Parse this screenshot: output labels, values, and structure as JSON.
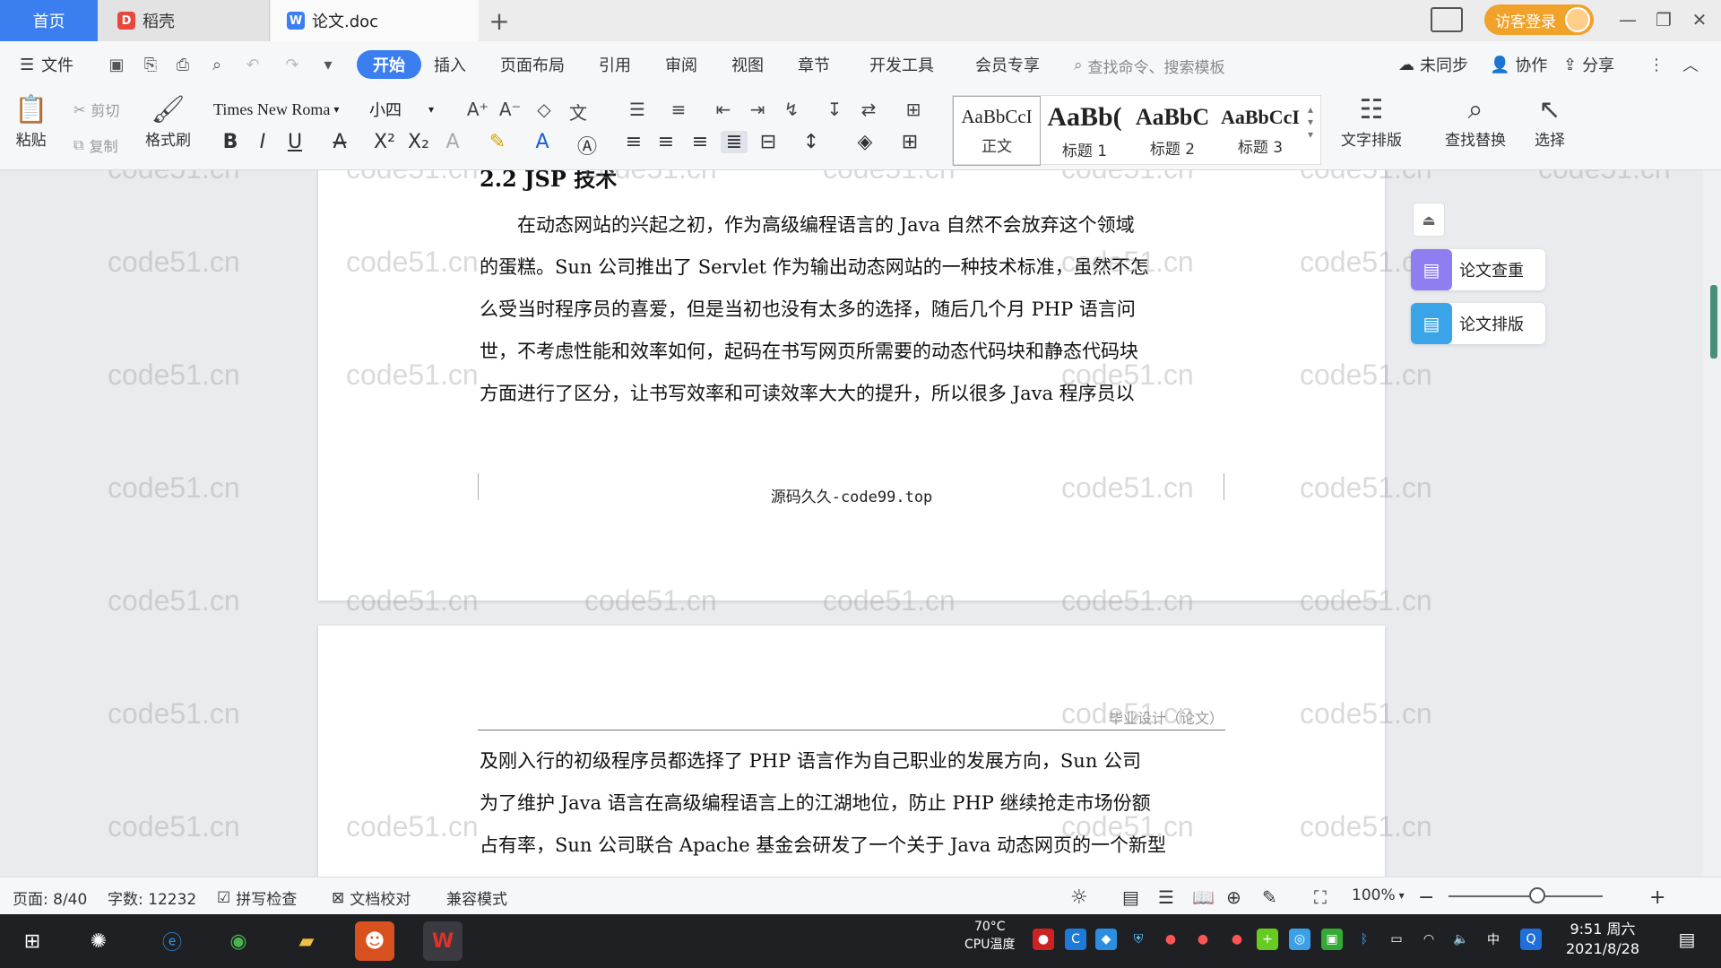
{
  "titlebar": {
    "tabs": [
      {
        "label": "首页"
      },
      {
        "label": "稻壳"
      },
      {
        "label": "论文.doc"
      }
    ],
    "login_label": "访客登录"
  },
  "menubar": {
    "file_label": "文件",
    "items": [
      "开始",
      "插入",
      "页面布局",
      "引用",
      "审阅",
      "视图",
      "章节",
      "开发工具",
      "会员专享"
    ],
    "search_placeholder": "查找命令、搜索模板",
    "sync_label": "未同步",
    "collab_label": "协作",
    "share_label": "分享"
  },
  "ribbon": {
    "paste_label": "粘贴",
    "cut_label": "剪切",
    "copy_label": "复制",
    "format_painter_label": "格式刷",
    "font_name": "Times New Roma",
    "font_size": "小四",
    "styles": [
      {
        "sample": "AaBbCcI",
        "name": "正文"
      },
      {
        "sample": "AaBb(",
        "name": "标题 1"
      },
      {
        "sample": "AaBbC",
        "name": "标题 2"
      },
      {
        "sample": "AaBbCcI",
        "name": "标题 3"
      }
    ],
    "text_layout_label": "文字排版",
    "find_replace_label": "查找替换",
    "select_label": "选择"
  },
  "document": {
    "section_heading": "2.2 JSP 技术",
    "page1_lines": [
      "在动态网站的兴起之初，作为高级编程语言的 Java 自然不会放弃这个领域",
      "的蛋糕。Sun 公司推出了 Servlet 作为输出动态网站的一种技术标准，虽然不怎",
      "么受当时程序员的喜爱，但是当初也没有太多的选择，随后几个月 PHP 语言问",
      "世，不考虑性能和效率如何，起码在书写网页所需要的动态代码块和静态代码块",
      "方面进行了区分，让书写效率和可读效率大大的提升，所以很多 Java 程序员以"
    ],
    "page1_footer": "源码久久-code99.top",
    "page2_header": "毕业设计（论文）",
    "page2_lines": [
      "及刚入行的初级程序员都选择了 PHP 语言作为自己职业的发展方向，Sun 公司",
      "为了维护 Java 语言在高级编程语言上的江湖地位，防止 PHP 继续抢走市场份额",
      "占有率，Sun 公司联合 Apache 基金会研发了一个关于 Java 动态网页的一个新型"
    ]
  },
  "side_panel": {
    "check_label": "论文查重",
    "layout_label": "论文排版"
  },
  "watermark": "code51.cn",
  "statusbar": {
    "page": "页面: 8/40",
    "words": "字数: 12232",
    "spell_check": "拼写检查",
    "proofread": "文档校对",
    "compat_mode": "兼容模式",
    "zoom": "100%"
  },
  "taskbar": {
    "temp": "70°C",
    "temp_label": "CPU温度",
    "time": "9:51 周六",
    "date": "2021/8/28"
  },
  "colors": {
    "accent": "#3b7ef0",
    "login": "#f0a22a",
    "taskbar": "#1f2024"
  }
}
